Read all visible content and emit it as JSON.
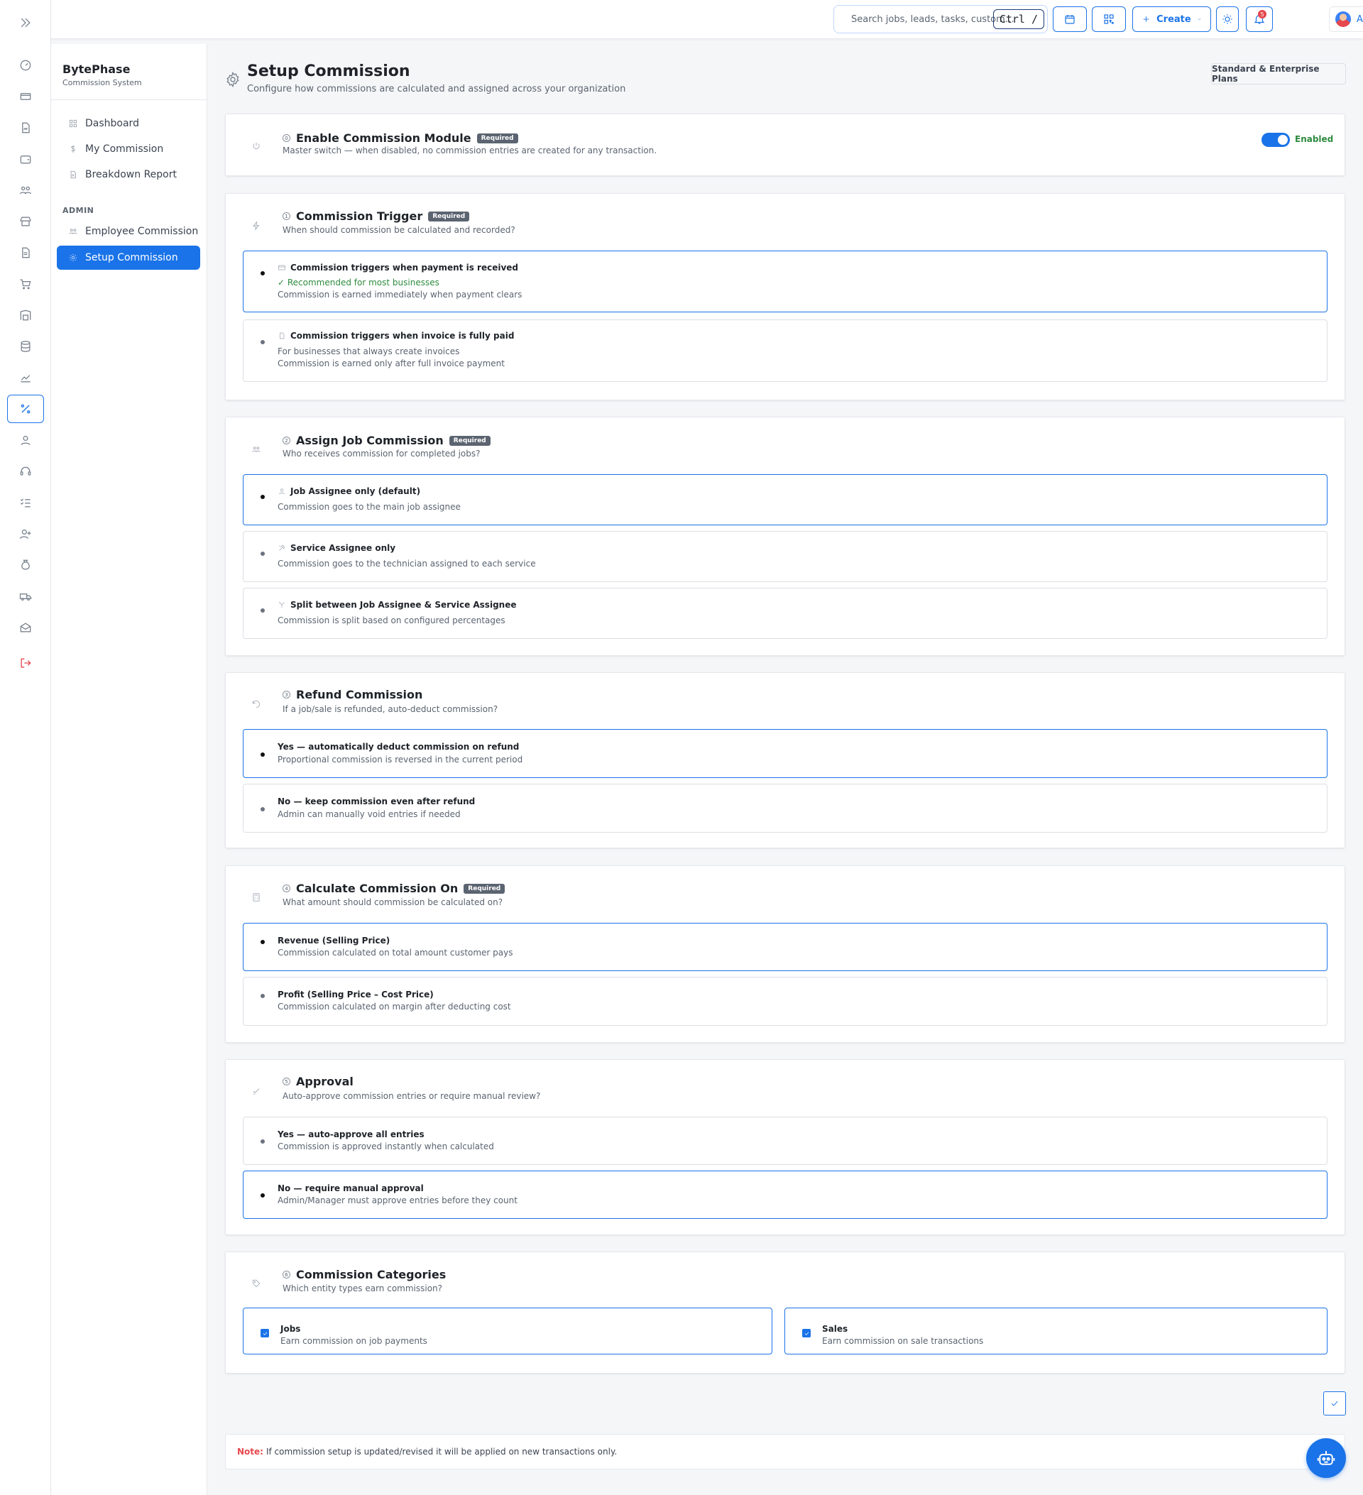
{
  "rail": {
    "icons": [
      "dashboard-icon",
      "billing-icon",
      "invoice-icon",
      "wallet-icon",
      "team-icon",
      "store-icon",
      "document-icon",
      "cart-icon",
      "warehouse-icon",
      "database-icon",
      "chart-icon",
      "percent-icon",
      "user-icon",
      "headset-icon",
      "checklist-icon",
      "add-user-icon",
      "money-bag-icon",
      "truck-icon",
      "mail-icon",
      "logout-icon"
    ],
    "active": "percent-icon"
  },
  "topbar": {
    "search_placeholder": "Search jobs, leads, tasks, custom…",
    "shortcut": "Ctrl /",
    "create_label": "Create",
    "notification_count": "5",
    "user_label": "Admin"
  },
  "subnav": {
    "brand": "BytePhase",
    "brand_sub": "Commission System",
    "items": [
      {
        "label": "Dashboard",
        "icon": "grid-icon"
      },
      {
        "label": "My Commission",
        "icon": "dollar-icon"
      },
      {
        "label": "Breakdown Report",
        "icon": "report-icon"
      }
    ],
    "admin_label": "ADMIN",
    "admin_items": [
      {
        "label": "Employee Commission",
        "icon": "users-icon"
      },
      {
        "label": "Setup Commission",
        "icon": "settings-icon",
        "active": true
      }
    ]
  },
  "page": {
    "title": "Setup Commission",
    "subtitle": "Configure how commissions are calculated and assigned across your organization",
    "plan_badge": "Standard & Enterprise Plans"
  },
  "required_label": "Required",
  "enable": {
    "step": "0",
    "title": "Enable Commission Module",
    "desc": "Master switch — when disabled, no commission entries are created for any transaction.",
    "toggle_label": "Enabled",
    "on": true
  },
  "trigger": {
    "step": "1",
    "title": "Commission Trigger",
    "desc": "When should commission be calculated and recorded?",
    "options": [
      {
        "title": "Commission triggers when payment is received",
        "line1": "✓ Recommended for most businesses",
        "line2": "Commission is earned immediately when payment clears",
        "selected": true
      },
      {
        "title": "Commission triggers when invoice is fully paid",
        "line1": "For businesses that always create invoices",
        "line2": "Commission is earned only after full invoice payment",
        "selected": false
      }
    ]
  },
  "assign": {
    "step": "2",
    "title": "Assign Job Commission",
    "desc": "Who receives commission for completed jobs?",
    "options": [
      {
        "title": "Job Assignee only (default)",
        "line1": "Commission goes to the main job assignee",
        "selected": true
      },
      {
        "title": "Service Assignee only",
        "line1": "Commission goes to the technician assigned to each service",
        "selected": false
      },
      {
        "title": "Split between Job Assignee & Service Assignee",
        "line1": "Commission is split based on configured percentages",
        "selected": false
      }
    ]
  },
  "refund": {
    "step": "3",
    "title": "Refund Commission",
    "desc": "If a job/sale is refunded, auto-deduct commission?",
    "options": [
      {
        "title": "Yes — automatically deduct commission on refund",
        "line1": "Proportional commission is reversed in the current period",
        "selected": true
      },
      {
        "title": "No — keep commission even after refund",
        "line1": "Admin can manually void entries if needed",
        "selected": false
      }
    ]
  },
  "calculate": {
    "step": "4",
    "title": "Calculate Commission On",
    "desc": "What amount should commission be calculated on?",
    "options": [
      {
        "title": "Revenue (Selling Price)",
        "line1": "Commission calculated on total amount customer pays",
        "selected": true
      },
      {
        "title": "Profit (Selling Price – Cost Price)",
        "line1": "Commission calculated on margin after deducting cost",
        "selected": false
      }
    ]
  },
  "approval": {
    "step": "5",
    "title": "Approval",
    "desc": "Auto-approve commission entries or require manual review?",
    "options": [
      {
        "title": "Yes — auto-approve all entries",
        "line1": "Commission is approved instantly when calculated",
        "selected": false
      },
      {
        "title": "No — require manual approval",
        "line1": "Admin/Manager must approve entries before they count",
        "selected": true
      }
    ]
  },
  "categories": {
    "step": "6",
    "title": "Commission Categories",
    "desc": "Which entity types earn commission?",
    "items": [
      {
        "title": "Jobs",
        "desc": "Earn commission on job payments",
        "checked": true
      },
      {
        "title": "Sales",
        "desc": "Earn commission on sale transactions",
        "checked": true
      }
    ]
  },
  "note": {
    "label": "Note:",
    "text": "If commission setup is updated/revised it will be applied on new transactions only."
  }
}
